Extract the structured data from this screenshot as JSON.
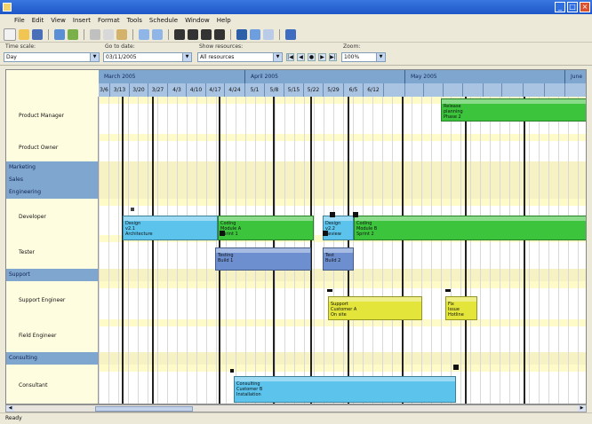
{
  "colors": {
    "blue_bar": "#5bc3ec",
    "green_bar": "#3cc43c",
    "slate_bar": "#6d8fcf",
    "yellow_bar": "#e3e53a",
    "row_alt": "#fffbc8",
    "group_header": "#7fa6cf"
  },
  "menu": [
    "File",
    "Edit",
    "View",
    "Insert",
    "Format",
    "Tools",
    "Schedule",
    "Window",
    "Help"
  ],
  "toolbar": {
    "view_label": "Time scale:",
    "view_value": "Day",
    "date_label": "Go to date:",
    "date_value": "03/11/2005",
    "zoom_label": "Zoom:",
    "zoom_value": "100%",
    "filter_label": "Show resources:",
    "filter_value": "All resources"
  },
  "timeline": {
    "quarters": [
      "March 2005",
      "April 2005",
      "May 2005",
      "June"
    ],
    "days": [
      "3/6",
      "3/13",
      "3/20",
      "3/27",
      "4/3",
      "4/10",
      "4/17",
      "4/24",
      "5/1",
      "5/8",
      "5/15",
      "5/22",
      "5/29",
      "6/5",
      "6/12"
    ]
  },
  "rows": [
    {
      "kind": "resource",
      "label": "Product Manager"
    },
    {
      "kind": "resource",
      "label": "Product Owner"
    },
    {
      "kind": "group",
      "label": "Marketing"
    },
    {
      "kind": "group",
      "label": "Sales"
    },
    {
      "kind": "group",
      "label": "Engineering"
    },
    {
      "kind": "resource",
      "label": "Developer"
    },
    {
      "kind": "resource",
      "label": "Tester"
    },
    {
      "kind": "group",
      "label": "Support"
    },
    {
      "kind": "resource",
      "label": "Support Engineer"
    },
    {
      "kind": "resource",
      "label": "Field Engineer"
    },
    {
      "kind": "group",
      "label": "Consulting"
    },
    {
      "kind": "resource",
      "label": "Consultant"
    }
  ],
  "bars": [
    {
      "name": "bar-release-planning",
      "color": "green",
      "lines": [
        "Release",
        "planning",
        "Phase 2"
      ]
    },
    {
      "name": "bar-design",
      "color": "blue",
      "lines": [
        "Design",
        "v2.1",
        "Architecture"
      ]
    },
    {
      "name": "bar-coding",
      "color": "green",
      "lines": [
        "Coding",
        "Module A",
        "Sprint 1"
      ]
    },
    {
      "name": "bar-design-2",
      "color": "blue",
      "lines": [
        "Design",
        "v2.2",
        "Review"
      ]
    },
    {
      "name": "bar-coding-2",
      "color": "green",
      "lines": [
        "Coding",
        "Module B",
        "Sprint 2"
      ]
    },
    {
      "name": "bar-testing",
      "color": "slate",
      "lines": [
        "Testing",
        "Build 1"
      ]
    },
    {
      "name": "bar-testing-2",
      "color": "slate",
      "lines": [
        "Test",
        "Build 2"
      ]
    },
    {
      "name": "bar-support-1",
      "color": "yellow",
      "lines": [
        "Support",
        "Customer A",
        "On site"
      ]
    },
    {
      "name": "bar-support-2",
      "color": "yellow",
      "lines": [
        "Fix",
        "Issue",
        "Hotline"
      ]
    },
    {
      "name": "bar-consulting",
      "color": "blue",
      "lines": [
        "Consulting",
        "Customer B",
        "Installation"
      ]
    }
  ],
  "status": "Ready"
}
